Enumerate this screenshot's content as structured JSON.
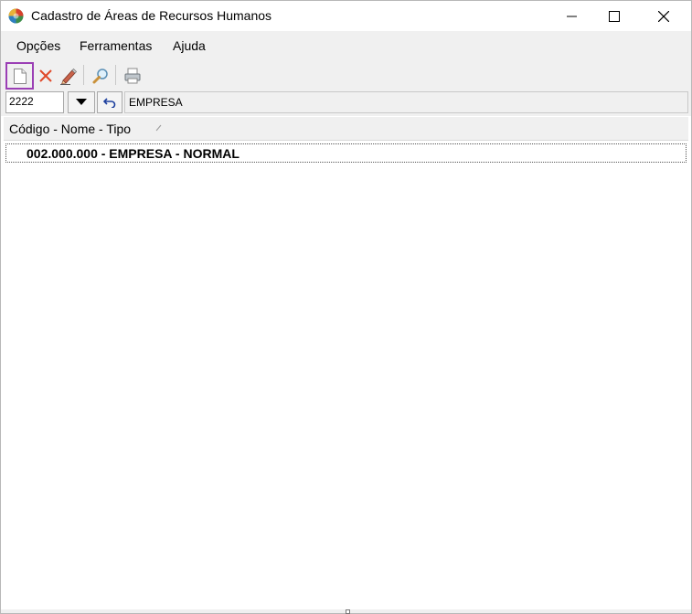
{
  "window": {
    "title": "Cadastro de Áreas de Recursos Humanos"
  },
  "menu": {
    "items": [
      {
        "label": "Opções"
      },
      {
        "label": "Ferramentas"
      },
      {
        "label": "Ajuda"
      }
    ]
  },
  "toolbar": {
    "icons": [
      "new-document-icon",
      "delete-icon",
      "edit-pencil-icon",
      "search-magnifier-icon",
      "print-icon"
    ],
    "highlight_color": "#9b3fb5"
  },
  "filter": {
    "code_value": "2222",
    "name_value": "EMPRESA"
  },
  "list": {
    "column_header": "Código - Nome - Tipo",
    "rows": [
      {
        "text": "002.000.000 - EMPRESA - NORMAL"
      }
    ]
  }
}
